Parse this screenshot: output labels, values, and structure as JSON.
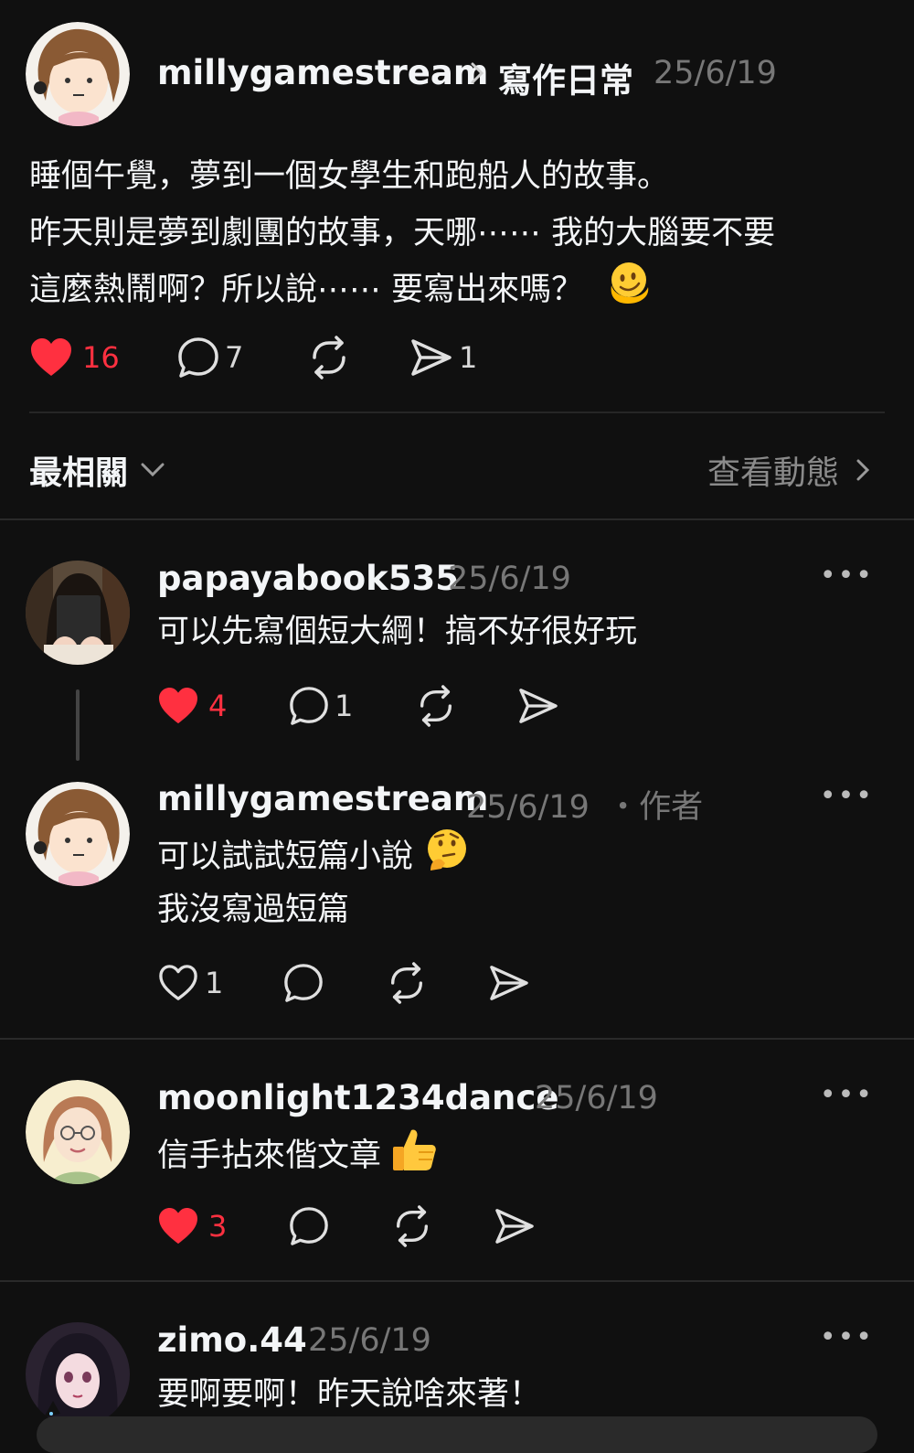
{
  "post": {
    "username": "millygamestream",
    "topic": "寫作日常",
    "date": "25/6/19",
    "lines": [
      "睡個午覺，夢到一個女學生和跑船人的故事。",
      "昨天則是夢到劇團的故事，天哪⋯⋯ 我的大腦要不要",
      "這麼熱鬧啊？所以說⋯⋯ 要寫出來嗎？"
    ],
    "likes": "16",
    "comments": "7",
    "shares": "1"
  },
  "sort": {
    "label": "最相關",
    "activity": "查看動態"
  },
  "replies": [
    {
      "username": "papayabook535",
      "date": "25/6/19",
      "author_tag": "",
      "lines": [
        "可以先寫個短大綱！搞不好很好玩"
      ],
      "likes": "4",
      "comments": "1"
    },
    {
      "username": "millygamestream",
      "date": "25/6/19",
      "author_tag": "・作者",
      "lines": [
        "可以試試短篇小說",
        "我沒寫過短篇"
      ],
      "likes": "1",
      "comments": ""
    },
    {
      "username": "moonlight1234dance",
      "date": "25/6/19",
      "author_tag": "",
      "lines": [
        "信手拈來偕文章"
      ],
      "likes": "3",
      "comments": ""
    },
    {
      "username": "zimo.44",
      "date": "25/6/19",
      "author_tag": "",
      "lines": [
        "要啊要啊！昨天說啥來著！"
      ],
      "likes": "",
      "comments": ""
    }
  ],
  "icons": {
    "like_active_color": "#ff3040",
    "more": "•••"
  }
}
